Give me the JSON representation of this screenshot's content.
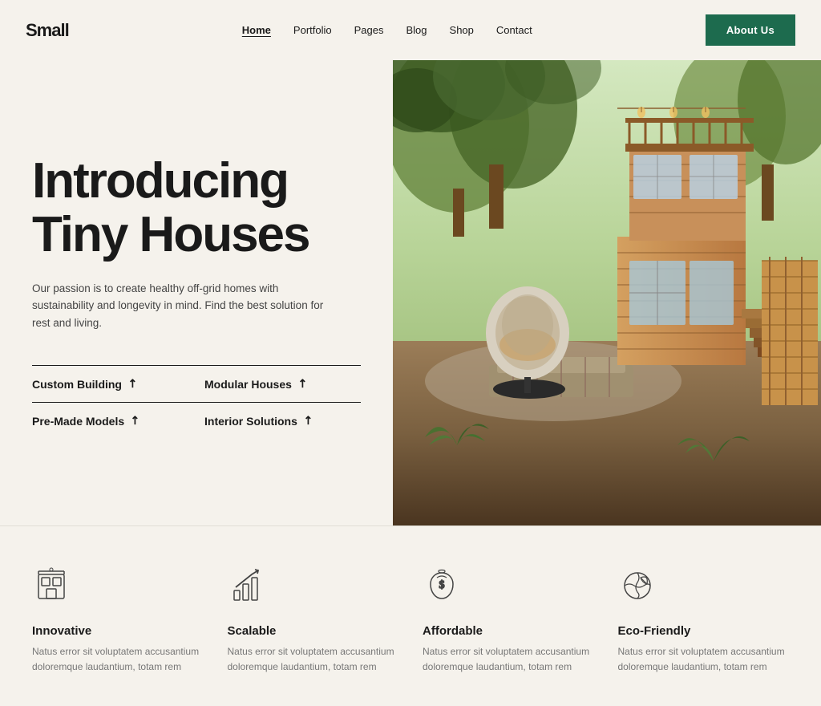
{
  "header": {
    "logo": "Small",
    "nav": [
      {
        "label": "Home",
        "active": true
      },
      {
        "label": "Portfolio",
        "active": false
      },
      {
        "label": "Pages",
        "active": false
      },
      {
        "label": "Blog",
        "active": false
      },
      {
        "label": "Shop",
        "active": false
      },
      {
        "label": "Contact",
        "active": false
      }
    ],
    "cta_button": "About Us"
  },
  "hero": {
    "title_line1": "Introducing",
    "title_line2": "Tiny Houses",
    "subtitle": "Our passion is to create healthy off-grid homes with sustainability and longevity in mind. Find the best solution for rest and living.",
    "links": [
      {
        "label": "Custom Building",
        "arrow": "↗"
      },
      {
        "label": "Modular Houses",
        "arrow": "↗"
      },
      {
        "label": "Pre-Made Models",
        "arrow": "↗"
      },
      {
        "label": "Interior Solutions",
        "arrow": "↗"
      }
    ]
  },
  "features": [
    {
      "title": "Innovative",
      "desc": "Natus error sit voluptatem accusantium doloremque laudantium, totam rem"
    },
    {
      "title": "Scalable",
      "desc": "Natus error sit voluptatem accusantium doloremque laudantium, totam rem"
    },
    {
      "title": "Affordable",
      "desc": "Natus error sit voluptatem accusantium doloremque laudantium, totam rem"
    },
    {
      "title": "Eco-Friendly",
      "desc": "Natus error sit voluptatem accusantium doloremque laudantium, totam rem"
    }
  ]
}
